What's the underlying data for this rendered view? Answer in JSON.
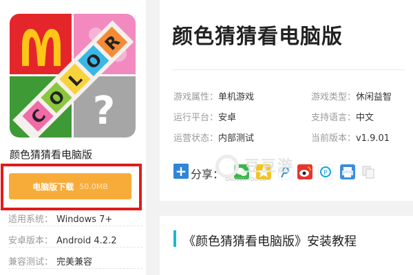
{
  "app": {
    "name": "颜色猜猜看电脑版",
    "icon_letters": [
      "C",
      "O",
      "L",
      "O",
      "R"
    ],
    "icon_question": "?"
  },
  "download": {
    "label": "电脑版下载",
    "size": "50.0MB"
  },
  "specs": [
    {
      "key": "适用系统：",
      "value": "Windows 7+"
    },
    {
      "key": "安卓版本：",
      "value": "Android 4.2.2"
    },
    {
      "key": "兼容测试：",
      "value": "完美兼容"
    }
  ],
  "title": "颜色猜猜看电脑版",
  "attributes": {
    "left": [
      {
        "key": "游戏属性：",
        "value": "单机游戏"
      },
      {
        "key": "运行平台：",
        "value": "安卓"
      },
      {
        "key": "运营状态：",
        "value": "内部测试"
      }
    ],
    "right": [
      {
        "key": "游戏类型：",
        "value": "休闲益智"
      },
      {
        "key": "支持语言：",
        "value": "中文"
      },
      {
        "key": "当前版本：",
        "value": "v1.9.01"
      }
    ]
  },
  "share": {
    "label": "分享：",
    "plus": "+",
    "icons": [
      "wechat-icon",
      "qzone-icon",
      "weibo-icon",
      "tencent-weibo-icon",
      "print-icon",
      "copy-icon"
    ]
  },
  "watermark": {
    "text": "豆豆游",
    "url": "GAOSOU YOU.COM"
  },
  "section": {
    "title": "《颜色猜猜看电脑版》安装教程"
  },
  "colors": {
    "download_bg": "#f7ac3a",
    "frame_red": "#e01b1b",
    "section_accent": "#1cb8d0",
    "share_blue": "#2f85d8"
  }
}
